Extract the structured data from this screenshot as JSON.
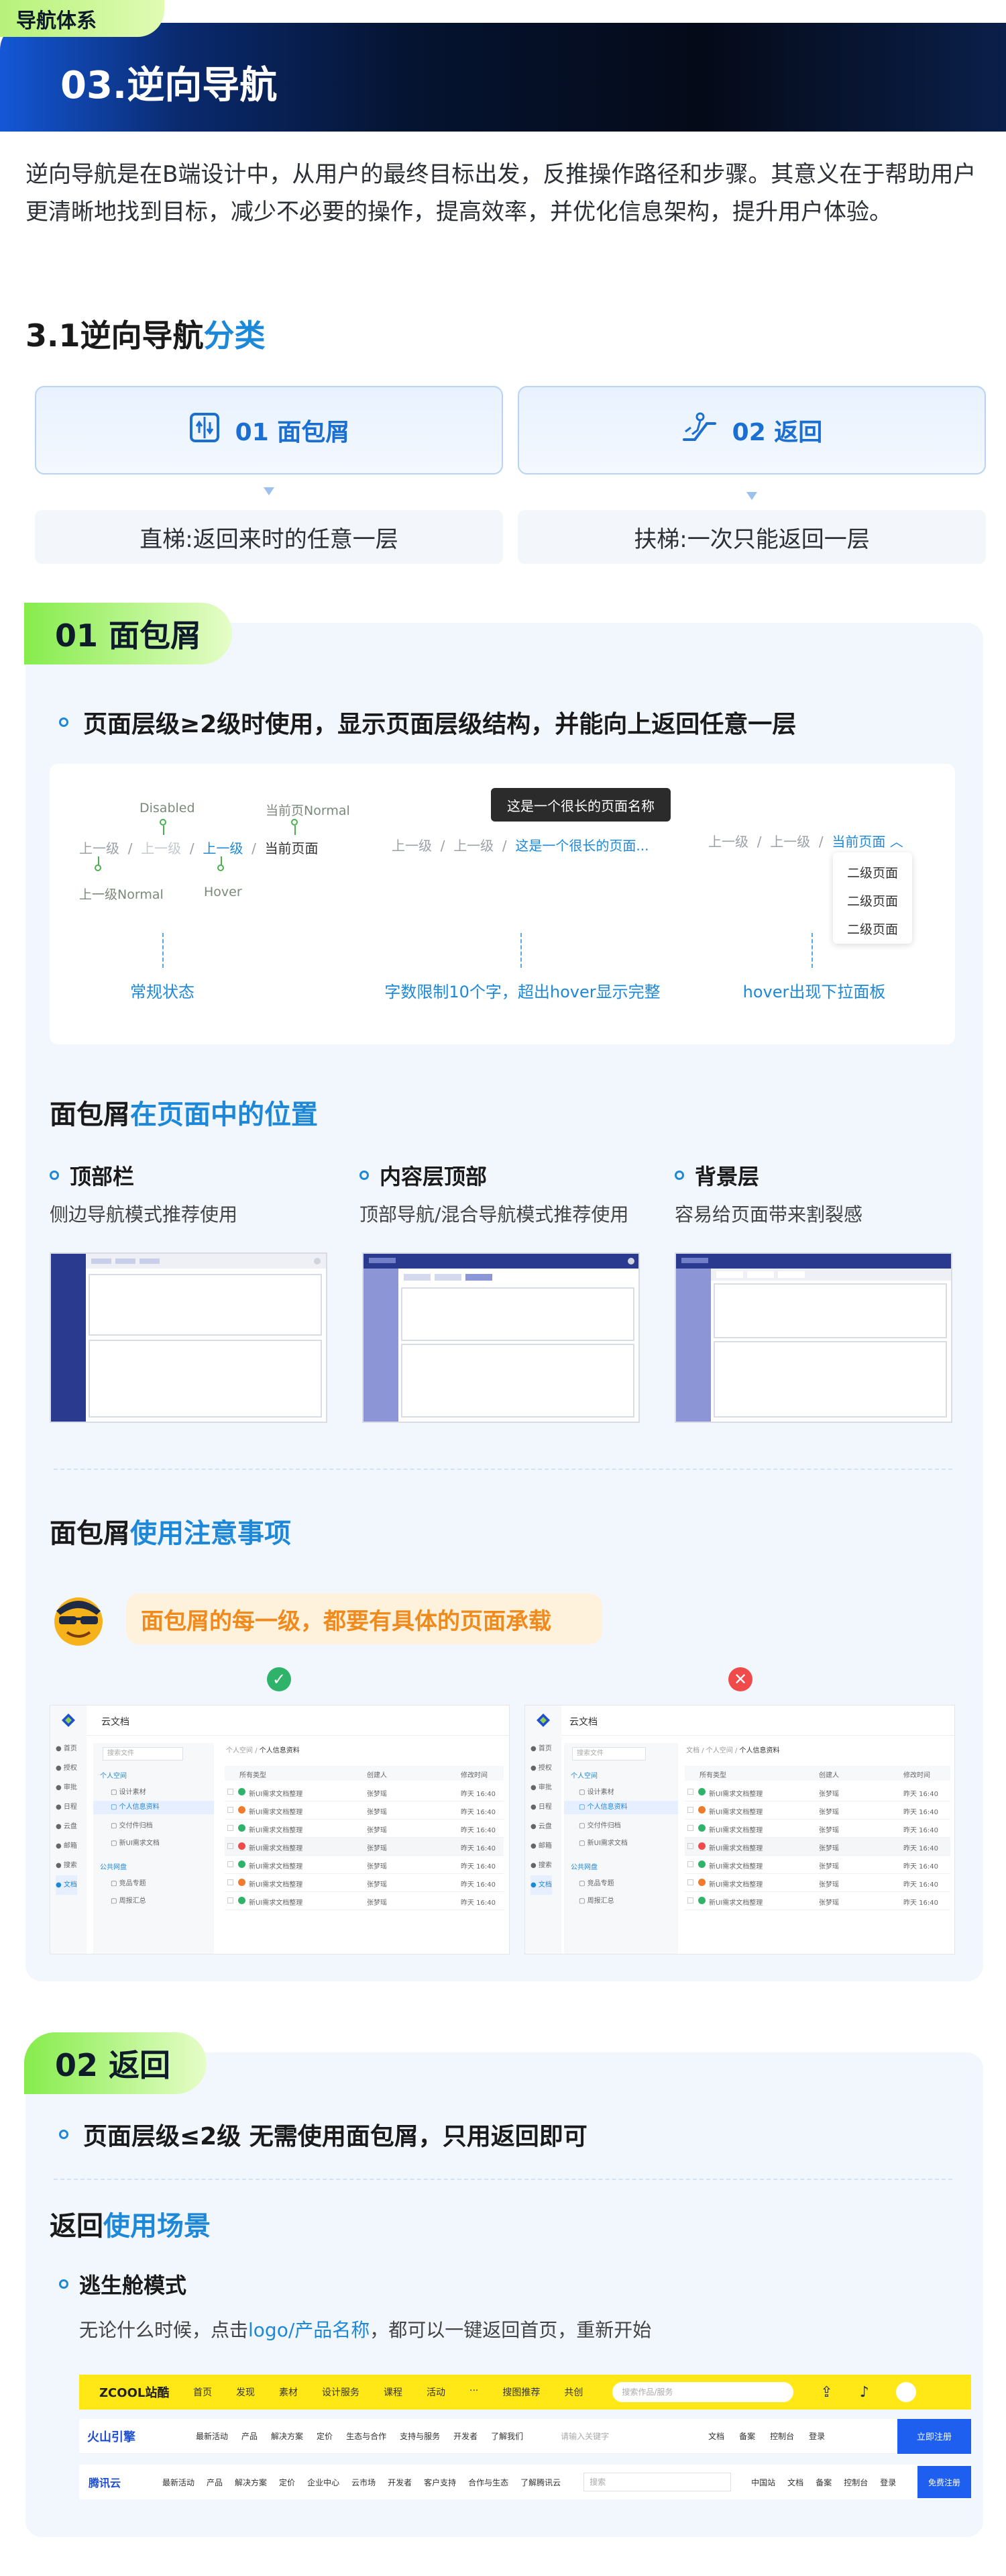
{
  "header": {
    "tag": "导航体系",
    "title": "03.逆向导航"
  },
  "intro": "逆向导航是在B端设计中，从用户的最终目标出发，反推操作路径和步骤。其意义在于帮助用户更清晰地找到目标，减少不必要的操作，提高效率，并优化信息架构，提升用户体验。",
  "section31": {
    "title_prefix": "3.1逆向导航",
    "title_accent": "分类"
  },
  "categories": [
    {
      "icon": "elevator-icon",
      "label": "01 面包屑",
      "desc": "直梯:返回来时的任意一层"
    },
    {
      "icon": "escalator-icon",
      "label": "02  返回",
      "desc": "扶梯:一次只能返回一层"
    }
  ],
  "breadcrumb": {
    "badge": "01 面包屑",
    "rule": "页面层级≥2级时使用，显示页面层级结构，并能向上返回任意一层",
    "demo1": {
      "disabled": "Disabled",
      "current_normal": "当前页Normal",
      "items": [
        "上一级",
        "/",
        "上一级",
        "/",
        "上一级",
        "/",
        "当前页面"
      ],
      "level_normal": "上一级Normal",
      "hover": "Hover",
      "caption": "常规状态"
    },
    "demo2": {
      "tooltip": "这是一个很长的页面名称",
      "items": [
        "上一级",
        "/",
        "上一级",
        "/",
        "这是一个很长的页面..."
      ],
      "caption": "字数限制10个字，超出hover显示完整"
    },
    "demo3": {
      "items": [
        "上一级",
        "/",
        "上一级",
        "/",
        "当前页面"
      ],
      "dropdown": [
        "二级页面",
        "二级页面",
        "二级页面"
      ],
      "caption": "hover出现下拉面板"
    },
    "position": {
      "title_prefix": "面包屑",
      "title_accent": "在页面中的位置",
      "items": [
        {
          "title": "顶部栏",
          "desc": "侧边导航模式推荐使用"
        },
        {
          "title": "内容层顶部",
          "desc": "顶部导航/混合导航模式推荐使用"
        },
        {
          "title": "背景层",
          "desc": "容易给页面带来割裂感"
        }
      ]
    },
    "notes": {
      "title_prefix": "面包屑",
      "title_accent": "使用注意事项",
      "tip": "面包屑的每一级，都要有具体的页面承载"
    },
    "examples": {
      "app_title": "云文档",
      "side_icons": [
        "首页",
        "授权",
        "审批",
        "日程",
        "云盘",
        "邮箱",
        "搜索",
        "文档"
      ],
      "search_placeholder": "搜索文件",
      "tree_group1": "个人空间",
      "tree_group2": "公共网盘",
      "tree_items1": [
        "设计素材",
        "个人信息资料",
        "交付件归档",
        "新UI需求文档"
      ],
      "tree_items2": [
        "竞品专题",
        "周报汇总"
      ],
      "good_crumb": [
        "个人空间",
        "/",
        "个人信息资料"
      ],
      "bad_crumb": [
        "文档",
        "/",
        "个人空间",
        "/",
        "个人信息资料"
      ],
      "columns": [
        "所有类型",
        "创建人",
        "修改时间"
      ],
      "row_name": "新UI需求文档整理",
      "row_owner": "张梦瑶",
      "row_time": "昨天 16:40",
      "row_count": 7
    }
  },
  "back": {
    "badge": "02 返回",
    "rule": "页面层级≤2级 无需使用面包屑，只用返回即可",
    "scene_prefix": "返回",
    "scene_accent": "使用场景",
    "mode_title": "逃生舱模式",
    "mode_desc_prefix": "无论什么时候，点击",
    "mode_desc_link": "logo/产品名称",
    "mode_desc_suffix": "，都可以一键返回首页，重新开始",
    "bars": [
      {
        "logo": "ZCOOL站酷",
        "items": [
          "首页",
          "发现",
          "素材",
          "设计服务",
          "课程",
          "活动",
          "···",
          "搜图推荐",
          "共创"
        ],
        "search": "搜索作品/服务",
        "right": []
      },
      {
        "logo": "火山引擎",
        "items": [
          "最新活动",
          "产品",
          "解决方案",
          "定价",
          "生态与合作",
          "支持与服务",
          "开发者",
          "了解我们"
        ],
        "search": "请输入关键字",
        "right": [
          "文档",
          "备案",
          "控制台",
          "登录"
        ],
        "cta": "立即注册"
      },
      {
        "logo": "腾讯云",
        "items": [
          "最新活动",
          "产品",
          "解决方案",
          "定价",
          "企业中心",
          "云市场",
          "开发者",
          "客户支持",
          "合作与生态",
          "了解腾讯云"
        ],
        "search": "搜索",
        "right": [
          "中国站",
          "文档",
          "备案",
          "控制台",
          "登录"
        ],
        "cta": "免费注册"
      }
    ]
  },
  "colors": {
    "accent_blue": "#1e88d8",
    "badge_green": "#86ec4c",
    "header_dark": "#050a18",
    "good": "#2fb36a",
    "bad": "#ef4b4b"
  }
}
